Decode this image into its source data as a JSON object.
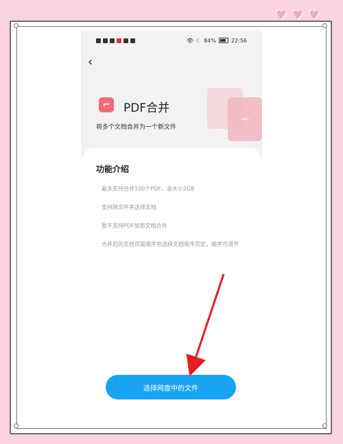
{
  "status_bar": {
    "battery": "84%",
    "time": "22:56"
  },
  "header": {
    "back_icon": "back-arrow-icon",
    "title": "PDF合并",
    "subtitle": "将多个文档合并为一个新文件"
  },
  "features": {
    "title": "功能介绍",
    "items": [
      "最多支持合并100个PDF，总大小2GB",
      "支持跨文件夹选择文档",
      "暂不支持PDF加密文档合并",
      "合并后的文档页面顺序依选择文档顺序而定，顺序可调节"
    ]
  },
  "actions": {
    "select_button": "选择网盘中的文件"
  },
  "colors": {
    "accent": "#1aa3f0",
    "pdf_icon": "#f26a7a",
    "arrow": "#e02020",
    "background": "#f9d3df"
  }
}
